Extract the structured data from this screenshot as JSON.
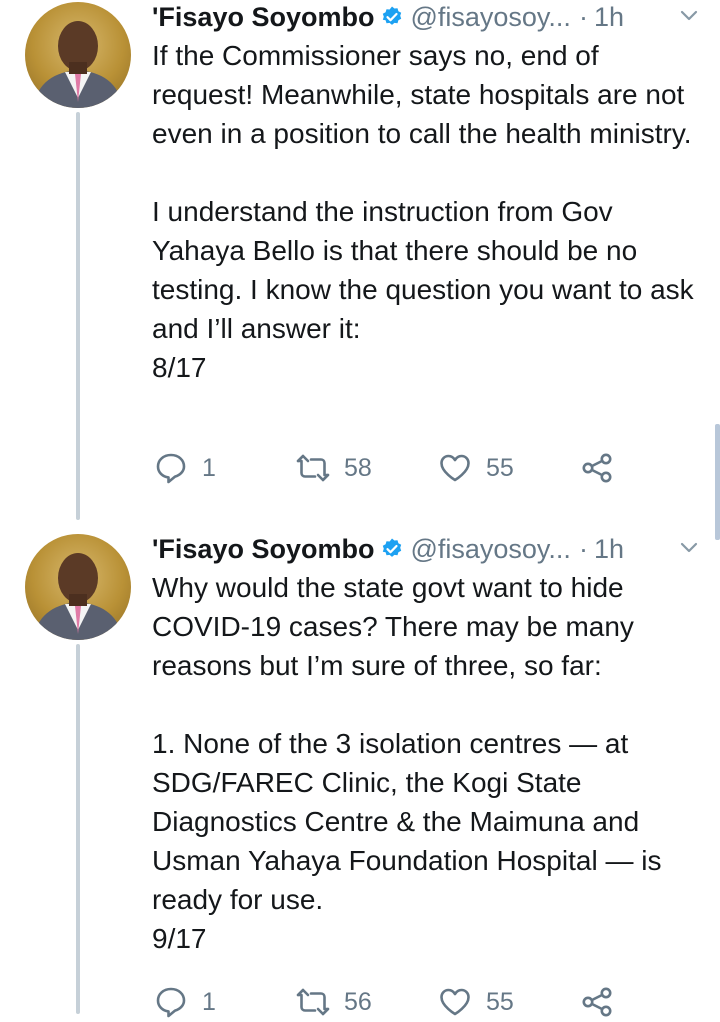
{
  "tweets": [
    {
      "name": "'Fisayo Soyombo",
      "handle": "@fisayosoy...",
      "separator": "·",
      "time": "1h",
      "paragraphs": [
        "If the Commissioner says no, end of request! Meanwhile, state hospitals are not even in a position to call the health ministry.",
        "I understand the instruction from Gov Yahaya Bello is that there should be no testing. I know the question you want to ask and I’ll answer it:\n8/17"
      ],
      "replies": "1",
      "retweets": "58",
      "likes": "55"
    },
    {
      "name": "'Fisayo Soyombo",
      "handle": "@fisayosoy...",
      "separator": "·",
      "time": "1h",
      "paragraphs": [
        "Why would the state govt want to hide COVID-19 cases? There may be many reasons but I’m sure of three, so far:",
        "1. None of the 3 isolation centres — at SDG/FAREC Clinic, the Kogi State Diagnostics Centre & the Maimuna and Usman Yahaya Foundation Hospital — is ready for use.\n9/17"
      ],
      "replies": "1",
      "retweets": "56",
      "likes": "55"
    }
  ],
  "icons": {
    "verified": "verified-badge-icon",
    "caret": "chevron-down-icon",
    "reply": "reply-icon",
    "retweet": "retweet-icon",
    "like": "heart-icon",
    "share": "share-icon"
  },
  "colors": {
    "text": "#14171a",
    "muted": "#657786",
    "verified": "#1da1f2",
    "thread_line": "#c6d0d8"
  }
}
